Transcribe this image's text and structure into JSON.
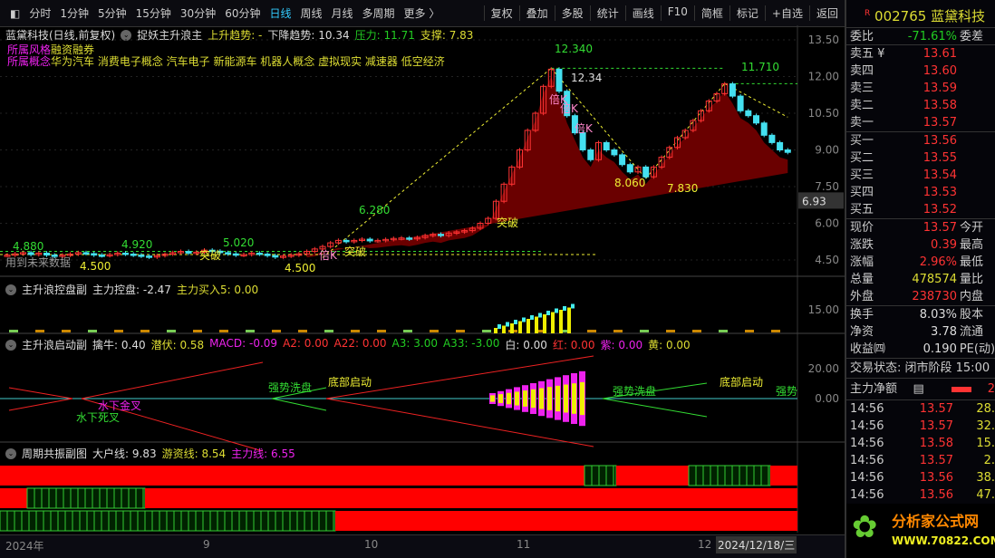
{
  "toolbar": {
    "items": [
      "分时",
      "1分钟",
      "5分钟",
      "15分钟",
      "30分钟",
      "60分钟",
      "日线",
      "周线",
      "月线",
      "多周期",
      "更多 〉"
    ],
    "active": "日线",
    "right": [
      "复权",
      "叠加",
      "多股",
      "统计",
      "画线",
      "F10",
      "简框",
      "标记",
      "+自选",
      "返回"
    ]
  },
  "main": {
    "title": "蓝黛科技(日线,前复权)",
    "indicator": "捉妖主升浪主",
    "up_trend": "上升趋势: -",
    "down_trend": "下降趋势: 10.34",
    "pressure": "压力: 11.71",
    "support": "支撑: 7.83",
    "style_label": "所属风格",
    "style_value": "融资融券",
    "concept_label": "所属概念",
    "concepts": "华为汽车 消费电子概念 汽车电子 新能源车 机器人概念 虚拟现实 减速器 低空经济",
    "note": "用到未来数据",
    "labels": [
      "12.340",
      "12.34",
      "11.710",
      "6.280",
      "4.880",
      "4.920",
      "5.020",
      "4.500",
      "4.500",
      "8.060",
      "7.830",
      "倍K",
      "倍K",
      "倍K",
      "突破",
      "突破",
      "突破",
      "倍K"
    ],
    "y_ticks": [
      "13.50",
      "12.00",
      "10.50",
      "9.00",
      "7.50",
      "6.00",
      "4.50"
    ],
    "last_price_tag": "6.93",
    "closes": [
      4.7,
      4.75,
      4.8,
      4.72,
      4.78,
      4.7,
      4.65,
      4.7,
      4.74,
      4.8,
      4.76,
      4.7,
      4.68,
      4.72,
      4.78,
      4.74,
      4.7,
      4.66,
      4.62,
      4.68,
      4.74,
      4.8,
      4.85,
      4.78,
      4.82,
      4.9,
      4.86,
      4.8,
      4.75,
      4.7,
      4.72,
      4.78,
      4.74,
      4.68,
      4.62,
      4.66,
      4.7,
      4.75,
      4.85,
      4.95,
      5.05,
      5.2,
      5.3,
      5.25,
      5.3,
      5.35,
      5.28,
      5.3,
      5.34,
      5.38,
      5.4,
      5.36,
      5.42,
      5.5,
      5.55,
      5.5,
      5.6,
      5.65,
      5.7,
      5.8,
      6.0,
      6.2,
      6.9,
      7.6,
      8.3,
      9.0,
      9.8,
      10.5,
      11.6,
      12.3,
      11.4,
      10.4,
      9.7,
      9.0,
      8.6,
      9.3,
      9.0,
      8.8,
      8.4,
      8.1,
      8.3,
      7.9,
      8.3,
      8.7,
      9.1,
      9.5,
      9.8,
      10.2,
      10.6,
      11.0,
      11.3,
      11.7,
      11.2,
      10.6,
      10.4,
      10.1,
      9.6,
      9.3,
      9.0,
      8.9
    ]
  },
  "sub1": {
    "name": "主升浪控盘副",
    "v1": "主力控盘: -2.47",
    "v2": "主力买入5: 0.00",
    "y_tick": "15.00"
  },
  "sub2": {
    "name": "主升浪启动副",
    "vals": [
      {
        "t": "擒牛: 0.40",
        "c": "#ddd"
      },
      {
        "t": "潜伏: 0.58",
        "c": "#dd3"
      },
      {
        "t": "MACD: -0.09",
        "c": "#e2e"
      },
      {
        "t": "A2: 0.00",
        "c": "#f33"
      },
      {
        "t": "A22: 0.00",
        "c": "#f33"
      },
      {
        "t": "A3: 3.00",
        "c": "#2c2"
      },
      {
        "t": "A33: -3.00",
        "c": "#2c2"
      },
      {
        "t": "白: 0.00",
        "c": "#ddd"
      },
      {
        "t": "红: 0.00",
        "c": "#f33"
      },
      {
        "t": "紫: 0.00",
        "c": "#e2e"
      },
      {
        "t": "黄: 0.00",
        "c": "#dd3"
      }
    ],
    "labels": [
      "强势洗盘",
      "底部启动",
      "强势洗盘",
      "底部启动",
      "强势",
      "水下死叉",
      "水下金叉"
    ],
    "y_ticks": [
      "20.00",
      "0.00"
    ]
  },
  "sub3": {
    "name": "周期共振副图",
    "v1": "大户线: 9.83",
    "v2": "游资线: 8.54",
    "v3": "主力线: 6.55"
  },
  "xaxis": {
    "labels": [
      "2024年",
      "9",
      "10",
      "11",
      "12"
    ],
    "cursor_date": "2024/12/18/三"
  },
  "quote": {
    "badge": "R",
    "code": "002765",
    "name": "蓝黛科技",
    "wb_label": "委比",
    "wb": "-71.61%",
    "wc_label": "委差",
    "asks": [
      {
        "l": "卖五 ¥",
        "v": "13.61"
      },
      {
        "l": "卖四",
        "v": "13.60"
      },
      {
        "l": "卖三",
        "v": "13.59"
      },
      {
        "l": "卖二",
        "v": "13.58"
      },
      {
        "l": "卖一",
        "v": "13.57"
      }
    ],
    "bids": [
      {
        "l": "买一",
        "v": "13.56"
      },
      {
        "l": "买二",
        "v": "13.55"
      },
      {
        "l": "买三",
        "v": "13.54"
      },
      {
        "l": "买四",
        "v": "13.53"
      },
      {
        "l": "买五",
        "v": "13.52"
      }
    ],
    "stats": [
      {
        "l": "现价",
        "v": "13.57",
        "r": "今开",
        "c": "red"
      },
      {
        "l": "涨跌",
        "v": "0.39",
        "r": "最高",
        "c": "red"
      },
      {
        "l": "涨幅",
        "v": "2.96%",
        "r": "最低",
        "c": "red"
      },
      {
        "l": "总量",
        "v": "478574",
        "r": "量比",
        "c": "yel"
      },
      {
        "l": "外盘",
        "v": "238730",
        "r": "内盘",
        "c": "red"
      }
    ],
    "stats2": [
      {
        "l": "换手",
        "v": "8.03%",
        "r": "股本"
      },
      {
        "l": "净资",
        "v": "3.78",
        "r": "流通"
      },
      {
        "l": "收益㈣",
        "v": "0.190",
        "r": "PE(动)"
      }
    ],
    "status": "交易状态: 闭市阶段 15:00",
    "net_label": "主力净额",
    "net_value": "2",
    "ticks": [
      {
        "t": "14:56",
        "p": "13.57",
        "q": "28."
      },
      {
        "t": "14:56",
        "p": "13.57",
        "q": "32."
      },
      {
        "t": "14:56",
        "p": "13.58",
        "q": "15."
      },
      {
        "t": "14:56",
        "p": "13.57",
        "q": "2."
      },
      {
        "t": "14:56",
        "p": "13.56",
        "q": "38."
      },
      {
        "t": "14:56",
        "p": "13.56",
        "q": "47."
      }
    ]
  },
  "logo": {
    "text": "分析家公式网",
    "url": "WWW.70822.COM"
  },
  "colors": {
    "up": "#ff3333",
    "down": "#44e0f0",
    "area": "#6a0000",
    "accent": "#33ccff"
  }
}
